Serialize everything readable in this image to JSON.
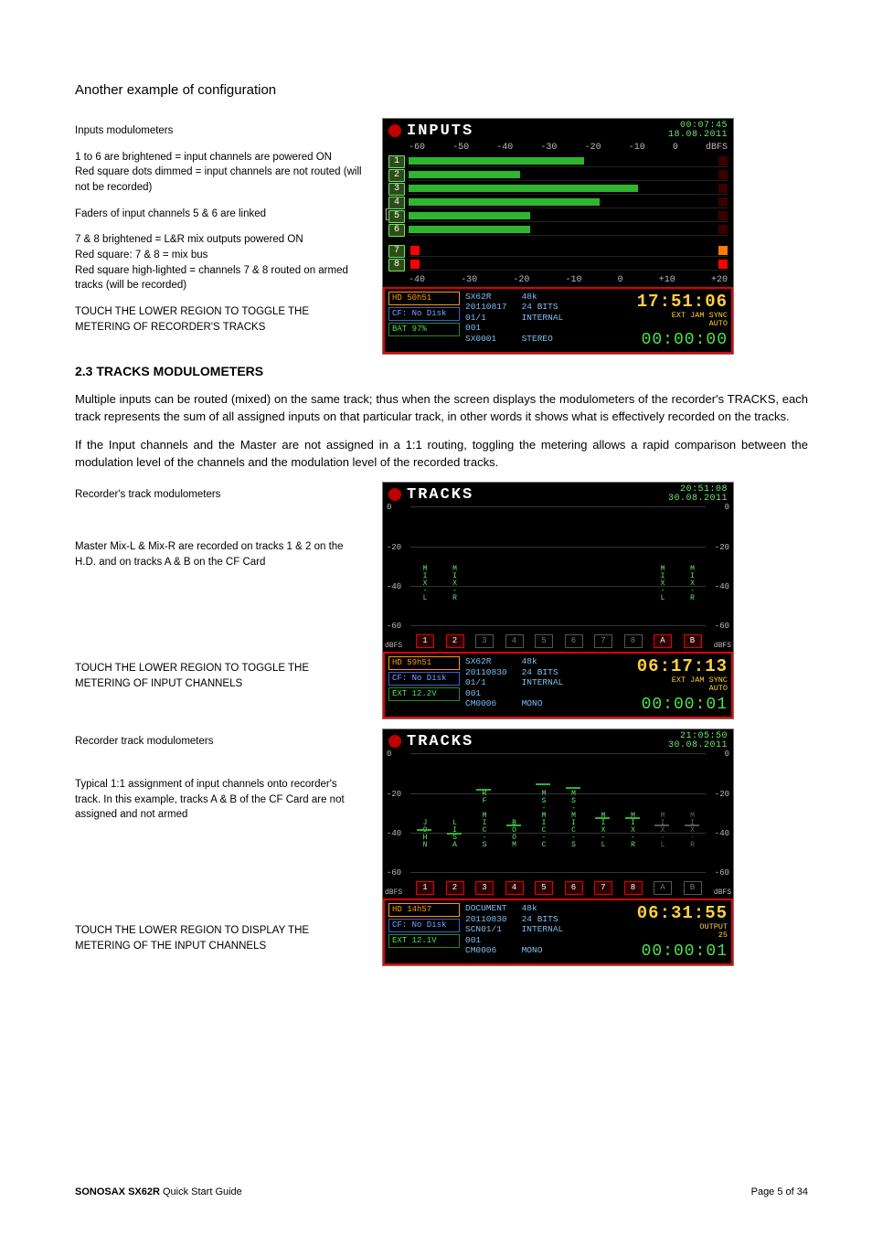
{
  "headings": {
    "config": "Another example of configuration",
    "tracks": "2.3  TRACKS MODULOMETERS"
  },
  "captions": {
    "a1": "Inputs modulometers",
    "a2": "1 to 6 are brightened = input channels are powered ON\nRed square dots dimmed = input channels are not routed  (will not be recorded)",
    "a3": "Faders of input channels 5 & 6 are linked",
    "a4": "7 & 8 brightened = L&R mix outputs powered ON\nRed square: 7 & 8 = mix bus\nRed square high-lighted = channels 7 & 8 routed on armed tracks (will be recorded)",
    "a5": "TOUCH THE LOWER REGION TO TOGGLE THE METERING  OF RECORDER'S TRACKS",
    "b1": "Recorder's track modulometers",
    "b2": "Master Mix-L & Mix-R are recorded on tracks 1 & 2 on the H.D. and on tracks A & B  on the CF Card",
    "b3": "TOUCH THE LOWER REGION TO TOGGLE THE METERING  OF INPUT CHANNELS",
    "c1": "Recorder track modulometers",
    "c2": "Typical 1:1 assignment of input channels onto recorder's track. In this  example, tracks A & B of the CF Card are not assigned and not armed",
    "c3": "TOUCH THE LOWER REGION  TO DISPLAY THE METERING  OF THE INPUT CHANNELS"
  },
  "body": {
    "p1": "Multiple inputs can be routed (mixed) on the same track; thus when the screen displays the modulometers of the recorder's TRACKS, each track represents the sum of all assigned inputs on that particular track, in other words it shows what is effectively recorded on the tracks.",
    "p2": "If the Input channels and the Master are not assigned in a 1:1 routing, toggling the metering allows a rapid comparison between the modulation level of the channels and the modulation level of the recorded tracks."
  },
  "inputs_screen": {
    "title": "INPUTS",
    "time": "00:07:45",
    "date": "18.08.2011",
    "top_scale": [
      "-60",
      "-50",
      "-40",
      "-30",
      "-20",
      "-10",
      "0",
      "dBFS"
    ],
    "channels": [
      {
        "n": "1",
        "bar": 55,
        "sq": "red-dim"
      },
      {
        "n": "2",
        "bar": 35,
        "sq": "red-dim"
      },
      {
        "n": "3",
        "bar": 72,
        "sq": "red-dim"
      },
      {
        "n": "4",
        "bar": 60,
        "sq": "red-dim"
      },
      {
        "n": "5",
        "bar": 38,
        "sq": "red-dim"
      },
      {
        "n": "6",
        "bar": 38,
        "sq": "red-dim"
      },
      {
        "n": "7",
        "bar": 0,
        "sq": "orange",
        "sq2": "red"
      },
      {
        "n": "8",
        "bar": 0,
        "sq": "red",
        "sq2": "red"
      }
    ],
    "bottom_scale": [
      "-40",
      "-30",
      "-20",
      "-10",
      "0",
      "+10",
      "+20"
    ],
    "status": {
      "hd": "HD 50h51",
      "cf": "CF: No Disk",
      "bat": "BAT 97%",
      "model": "SX62R",
      "date": "20110817",
      "take": "01/1",
      "idx": "001",
      "name": "SX0001",
      "sr": "48k",
      "bits": "24 BITS",
      "clk": "INTERNAL",
      "mode": "STEREO",
      "tc": "17:51:06",
      "sync1": "EXT JAM SYNC",
      "sync2": "AUTO",
      "elapsed": "00:00:00"
    }
  },
  "tracks_screen1": {
    "title": "TRACKS",
    "time": "20:51:08",
    "date": "30.08.2011",
    "y_ticks": [
      "0",
      "-20",
      "-40",
      "-60",
      "dBFS"
    ],
    "cols": [
      {
        "n": "1",
        "name": "MIX-L",
        "armed": true
      },
      {
        "n": "2",
        "name": "MIX-R",
        "armed": true
      },
      {
        "n": "3",
        "name": "",
        "armed": false
      },
      {
        "n": "4",
        "name": "",
        "armed": false
      },
      {
        "n": "5",
        "name": "",
        "armed": false
      },
      {
        "n": "6",
        "name": "",
        "armed": false
      },
      {
        "n": "7",
        "name": "",
        "armed": false
      },
      {
        "n": "8",
        "name": "",
        "armed": false
      },
      {
        "n": "A",
        "name": "MIX-L",
        "armed": true
      },
      {
        "n": "B",
        "name": "MIX-R",
        "armed": true
      }
    ],
    "status": {
      "hd": "HD 59h51",
      "cf": "CF: No Disk",
      "bat": "EXT 12.2V",
      "model": "SX62R",
      "date": "20110830",
      "take": "01/1",
      "idx": "001",
      "name": "CM0006",
      "sr": "48k",
      "bits": "24 BITS",
      "clk": "INTERNAL",
      "mode": "MONO",
      "tc": "06:17:13",
      "sync1": "EXT JAM SYNC",
      "sync2": "AUTO",
      "elapsed": "00:00:01"
    }
  },
  "tracks_screen2": {
    "title": "TRACKS",
    "time": "21:05:50",
    "date": "30.08.2011",
    "y_ticks": [
      "0",
      "-20",
      "-40",
      "-60",
      "dBFS"
    ],
    "cols": [
      {
        "n": "1",
        "name": "JOHN",
        "peak": -38,
        "armed": true
      },
      {
        "n": "2",
        "name": "LISA",
        "peak": -40,
        "armed": true
      },
      {
        "n": "3",
        "name": "RF MIC-S",
        "peak": -18,
        "armed": true
      },
      {
        "n": "4",
        "name": "BOOM",
        "peak": -36,
        "armed": true
      },
      {
        "n": "5",
        "name": "MS-MIC-C",
        "peak": -15,
        "armed": true
      },
      {
        "n": "6",
        "name": "MS-MIC-S",
        "peak": -17,
        "armed": true
      },
      {
        "n": "7",
        "name": "MIX-L",
        "peak": -32,
        "armed": true
      },
      {
        "n": "8",
        "name": "MIX-R",
        "peak": -32,
        "armed": true
      },
      {
        "n": "A",
        "name": "MIX-L",
        "peak": -36,
        "armed": false
      },
      {
        "n": "B",
        "name": "MIX-R",
        "peak": -36,
        "armed": false
      }
    ],
    "status": {
      "hd": "HD 14h57",
      "cf": "CF: No Disk",
      "bat": "EXT 12.1V",
      "model": "DOCUMENT",
      "date": "20110830",
      "take": "SCN01/1",
      "idx": "001",
      "name": "CM0006",
      "sr": "48k",
      "bits": "24 BITS",
      "clk": "INTERNAL",
      "mode": "MONO",
      "tc": "06:31:55",
      "sync1": "OUTPUT",
      "sync2": "25",
      "elapsed": "00:00:01"
    }
  },
  "footer": {
    "left_bold": "SONOSAX  SX62R",
    "left_rest": " Quick Start Guide",
    "right": "Page 5 of 34"
  }
}
